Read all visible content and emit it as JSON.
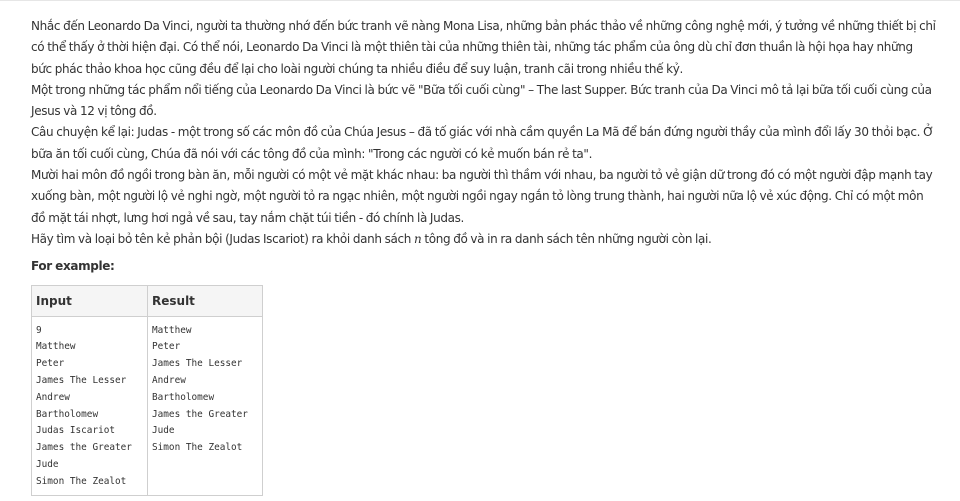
{
  "paragraphs": [
    "Nhắc đến Leonardo Da Vinci, người ta thường nhớ đến bức tranh vẽ nàng Mona Lisa, những bản phác thảo về những công nghệ mới, ý tưởng về những thiết bị chỉ có thể thấy ở thời hiện đại. Có thể nói, Leonardo Da Vinci là một thiên tài của những thiên tài, những tác phẩm của ông dù chỉ đơn thuần là hội họa hay những bức phác thảo khoa học cũng đều để lại cho loài người chúng ta nhiều điều để suy luận, tranh cãi trong nhiều thế kỷ.",
    "Một trong những tác phẩm nổi tiếng của Leonardo Da Vinci là bức vẽ \"Bữa tối cuối cùng\" – The last Supper. Bức tranh của Da Vinci mô tả lại bữa tối cuối cùng của Jesus và 12 vị tông đồ.",
    "Câu chuyện kể lại: Judas - một trong số các môn đồ của Chúa Jesus – đã tố giác với nhà cầm quyền La Mã để bán đứng người thầy của mình đổi lấy 30 thỏi bạc. Ở bữa ăn tối cuối cùng, Chúa đã nói với các tông đồ của mình: \"Trong các người có kẻ muốn bán rẻ ta\".",
    "Mười hai môn đồ ngồi trong bàn ăn, mỗi người có một vẻ mặt khác nhau: ba người thì thầm với nhau, ba người tỏ vẻ giận dữ trong đó có một người đập mạnh tay xuống bàn, một người lộ vẻ nghi ngờ, một người tỏ ra ngạc nhiên, một người ngồi ngay ngắn tỏ lòng trung thành, hai người nữa lộ vẻ xúc động. Chỉ có một môn đồ mặt tái nhợt, lưng hơi ngả về sau, tay nắm chặt túi tiền - đó chính là Judas."
  ],
  "task": {
    "before": "Hãy tìm và loại bỏ tên kẻ phản bội (Judas  Iscariot) ra khỏi danh sách ",
    "variable": "n",
    "after": " tông đồ và in ra danh sách tên những người còn lại."
  },
  "example_heading": "For example:",
  "example_table": {
    "headers": [
      "Input",
      "Result"
    ],
    "input_lines": [
      "9",
      "Matthew",
      "Peter",
      "James The Lesser",
      "Andrew",
      "Bartholomew",
      "Judas Iscariot",
      "James the Greater",
      "Jude",
      "Simon The Zealot"
    ],
    "result_lines": [
      "Matthew",
      "Peter",
      "James The Lesser",
      "Andrew",
      "Bartholomew",
      "James the Greater",
      "Jude",
      "Simon The Zealot"
    ]
  }
}
